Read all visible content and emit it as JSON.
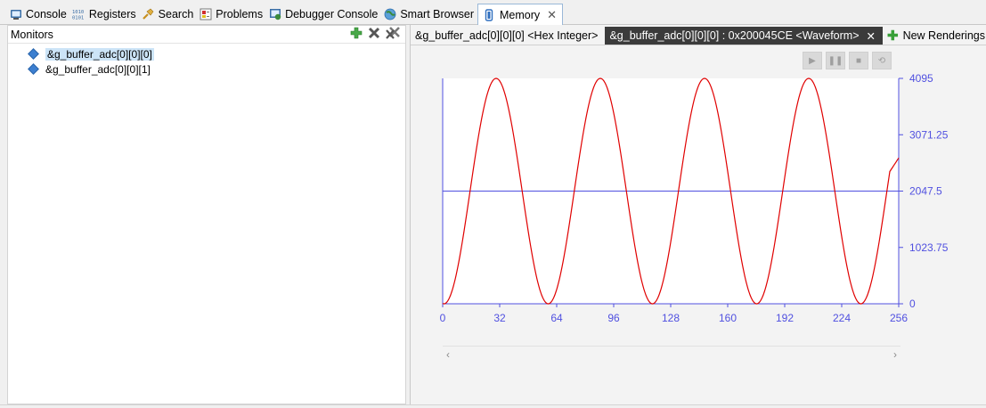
{
  "view_tabs": [
    {
      "label": "Console",
      "icon": "console-icon"
    },
    {
      "label": "Registers",
      "icon": "registers-icon"
    },
    {
      "label": "Search",
      "icon": "search-icon"
    },
    {
      "label": "Problems",
      "icon": "problems-icon"
    },
    {
      "label": "Debugger Console",
      "icon": "debugger-console-icon"
    },
    {
      "label": "Smart Browser",
      "icon": "smart-browser-icon"
    },
    {
      "label": "Memory",
      "icon": "memory-icon",
      "active": true
    }
  ],
  "monitors": {
    "title": "Monitors",
    "items": [
      {
        "label": "&g_buffer_adc[0][0][0]",
        "selected": true
      },
      {
        "label": "&g_buffer_adc[0][0][1]",
        "selected": false
      }
    ]
  },
  "renderings": {
    "tabs": [
      {
        "label": "&g_buffer_adc[0][0][0] <Hex Integer>"
      },
      {
        "label": "&g_buffer_adc[0][0][0] : 0x200045CE <Waveform>",
        "active": true
      }
    ],
    "new_label": "New Renderings..."
  },
  "colors": {
    "wave": "#e00000",
    "axis": "#5050e0",
    "accent": "#9ab8d8"
  },
  "chart_data": {
    "type": "line",
    "title": "",
    "xlabel": "",
    "ylabel": "",
    "xlim": [
      0,
      256
    ],
    "ylim": [
      0,
      4095
    ],
    "x_ticks": [
      0,
      32,
      64,
      96,
      128,
      160,
      192,
      224,
      256
    ],
    "y_ticks": [
      0,
      1023.75,
      2047.5,
      3071.25,
      4095
    ],
    "y_tick_labels": [
      "0",
      "1023.75",
      "2047.5",
      "3071.25",
      "4095"
    ],
    "reference_line": 2047.5,
    "series": [
      {
        "period_samples": 58.5,
        "first_peak_x": 30,
        "min": 0,
        "max": 4095,
        "last_value": 2650
      }
    ],
    "grid": false
  }
}
